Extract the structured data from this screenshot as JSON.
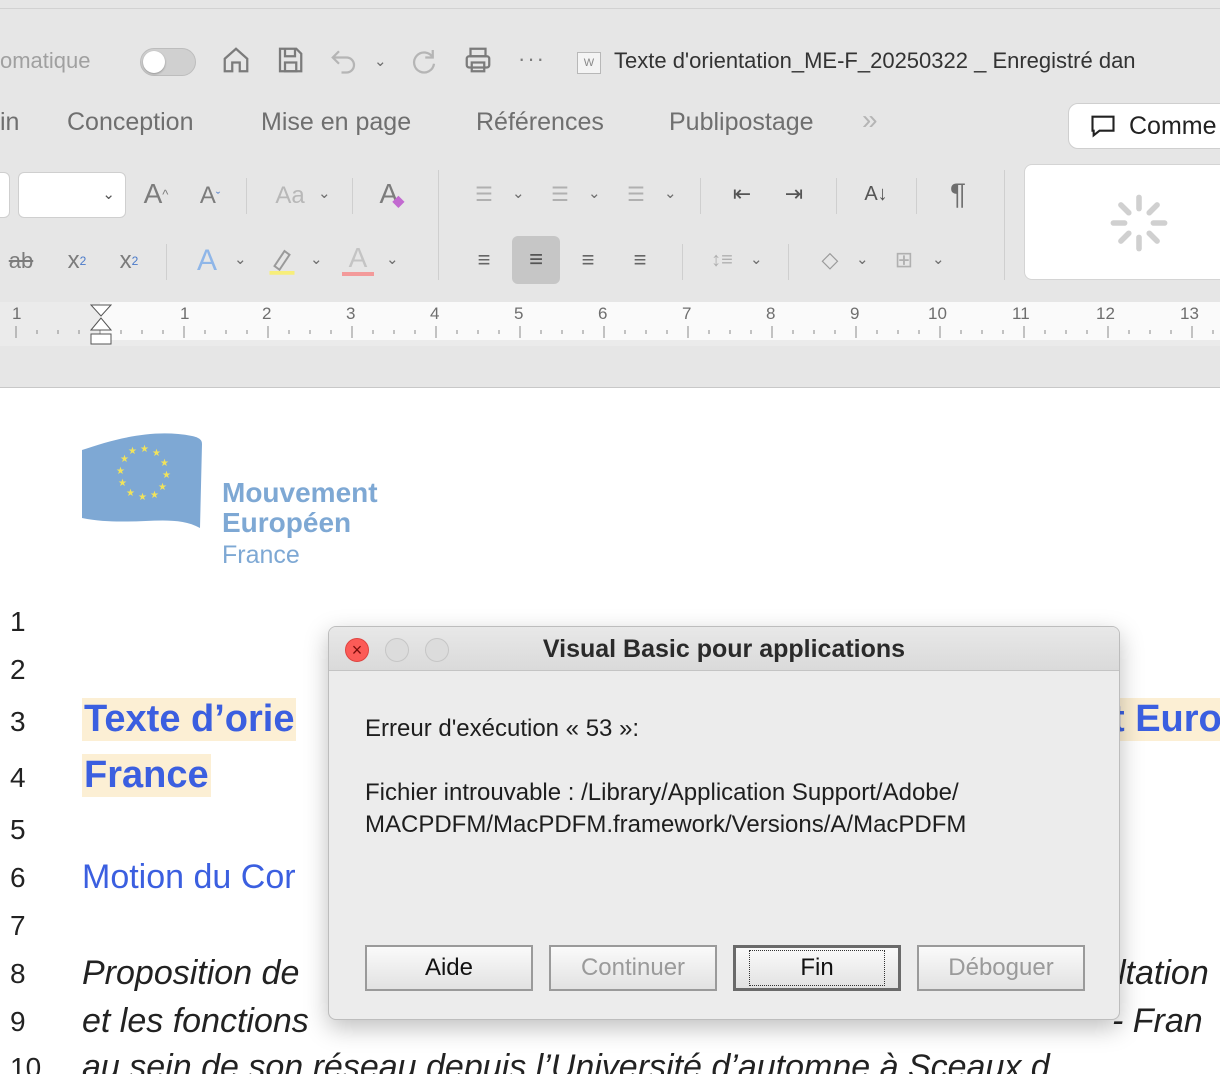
{
  "quick_access": {
    "autosave_label": "omatique",
    "document_title": "Texte d'orientation_ME-F_20250322 _ Enregistré dan"
  },
  "ribbon": {
    "tabs": [
      {
        "label": "in"
      },
      {
        "label": "Conception"
      },
      {
        "label": "Mise en page"
      },
      {
        "label": "Références"
      },
      {
        "label": "Publipostage"
      }
    ],
    "more_tabs": "»",
    "comment_label": "Comme",
    "font_size_value": ""
  },
  "ruler": {
    "numbers": [
      "1",
      "1",
      "2",
      "3",
      "4",
      "5",
      "6",
      "7",
      "8",
      "9",
      "10",
      "11",
      "12",
      "13"
    ]
  },
  "document": {
    "logo": {
      "line1": "Mouvement",
      "line2": "Européen",
      "line3": "France"
    },
    "line_numbers": [
      "1",
      "2",
      "3",
      "4",
      "5",
      "6",
      "7",
      "8",
      "9",
      "10"
    ],
    "heading_part1": "Texte d’orie",
    "heading_part2": "t Euro",
    "heading_line2": "France",
    "subheading": "Motion du Cor",
    "italic_line8_left": "Proposition de",
    "italic_line8_right": "ltation",
    "italic_line9_left": "et les fonctions",
    "italic_line9_right": "- Fran",
    "italic_line10": "au sein de son réseau depuis l’Université d’automne à Sceaux d"
  },
  "dialog": {
    "title": "Visual Basic pour applications",
    "error_code_line": "Erreur d'exécution « 53 »:",
    "message_line1": "Fichier introuvable : /Library/Application Support/Adobe/",
    "message_line2": "MACPDFM/MacPDFM.framework/Versions/A/MacPDFM",
    "buttons": {
      "help": "Aide",
      "continue": "Continuer",
      "end": "Fin",
      "debug": "Déboguer"
    }
  },
  "colors": {
    "heading_blue": "#3b5fe0",
    "heading_highlight": "#fcefd4",
    "logo_blue": "#7ea8d4",
    "close_red": "#fc5b57"
  }
}
